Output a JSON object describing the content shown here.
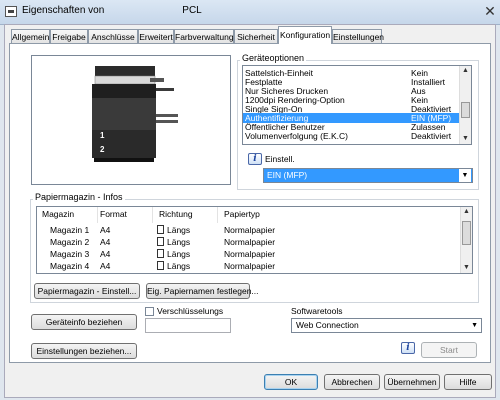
{
  "window": {
    "title_prefix": "Eigenschaften von",
    "title_suffix": "PCL",
    "close_glyph": "✕"
  },
  "tabs": [
    {
      "label": "Allgemein"
    },
    {
      "label": "Freigabe"
    },
    {
      "label": "Anschlüsse"
    },
    {
      "label": "Erweitert"
    },
    {
      "label": "Farbverwaltung"
    },
    {
      "label": "Sicherheit"
    },
    {
      "label": "Konfiguration",
      "active": true
    },
    {
      "label": "Einstellungen"
    }
  ],
  "device_options": {
    "label": "Geräteoptionen",
    "items": [
      {
        "name": "Sattelstich-Einheit",
        "value": "Kein"
      },
      {
        "name": "Festplatte",
        "value": "Installiert"
      },
      {
        "name": "Nur Sicheres Drucken",
        "value": "Aus"
      },
      {
        "name": "1200dpi Rendering-Option",
        "value": "Kein"
      },
      {
        "name": "Single Sign-On",
        "value": "Deaktiviert"
      },
      {
        "name": "Authentifizierung",
        "value": "EIN (MFP)",
        "selected": true
      },
      {
        "name": "Öffentlicher Benutzer",
        "value": "Zulassen"
      },
      {
        "name": "Volumenverfolgung (E.K.C)",
        "value": "Deaktiviert"
      }
    ],
    "setting_label": "Einstell.",
    "setting_value": "EIN (MFP)"
  },
  "preview": {
    "tray_1": "1",
    "tray_2": "2"
  },
  "paper_trays": {
    "label": "Papiermagazin - Infos",
    "columns": [
      "Magazin",
      "Format",
      "Richtung",
      "Papiertyp"
    ],
    "rows": [
      {
        "tray": "Magazin 1",
        "format": "A4",
        "direction": "Längs",
        "type": "Normalpapier"
      },
      {
        "tray": "Magazin 2",
        "format": "A4",
        "direction": "Längs",
        "type": "Normalpapier"
      },
      {
        "tray": "Magazin 3",
        "format": "A4",
        "direction": "Längs",
        "type": "Normalpapier"
      },
      {
        "tray": "Magazin 4",
        "format": "A4",
        "direction": "Längs",
        "type": "Normalpapier"
      }
    ],
    "settings_button": "Papiermagazin - Einstell...",
    "names_button": "Eig. Papiernamen festlegen..."
  },
  "device_info_button": "Geräteinfo beziehen",
  "encryption_label": "Verschlüsselungs",
  "settings_fetch_button": "Einstellungen beziehen...",
  "software_tools": {
    "label": "Softwaretools",
    "selected": "Web Connection",
    "start_button": "Start"
  },
  "footer": {
    "ok": "OK",
    "cancel": "Abbrechen",
    "apply": "Übernehmen",
    "help": "Hilfe"
  },
  "icons": {
    "info": "i",
    "dropdown": "▼",
    "scroll_up": "▲",
    "scroll_down": "▼"
  }
}
